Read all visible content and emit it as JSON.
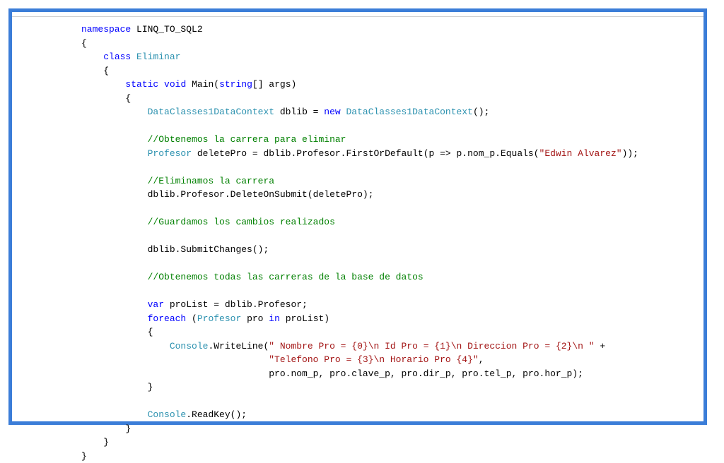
{
  "code": {
    "ns_kw": "namespace",
    "ns_name": " LINQ_TO_SQL2",
    "open1": "{",
    "class_kw": "class",
    "class_name": "Eliminar",
    "open2": "{",
    "static_kw": "static",
    "void_kw": "void",
    "main_name": " Main(",
    "string_kw": "string",
    "main_rest": "[] args)",
    "open3": "{",
    "dc_type1": "DataClasses1DataContext",
    "dc_mid": " dblib = ",
    "new_kw": "new",
    "dc_type2": "DataClasses1DataContext",
    "dc_end": "();",
    "c1": "//Obtenemos la carrera para eliminar",
    "prof_type": "Profesor",
    "del_mid": " deletePro = dblib.Profesor.FirstOrDefault(p => p.nom_p.Equals(",
    "del_str": "\"Edwin Alvarez\"",
    "del_end": "));",
    "c2": "//Eliminamos la carrera",
    "del_stmt": "dblib.Profesor.DeleteOnSubmit(deletePro);",
    "c3": "//Guardamos los cambios realizados",
    "submit": "dblib.SubmitChanges();",
    "c4": "//Obtenemos todas las carreras de la base de datos",
    "var_kw": "var",
    "var_rest": " proList = dblib.Profesor;",
    "foreach_kw": "foreach",
    "fe_p1": " (",
    "fe_type": "Profesor",
    "fe_mid": " pro ",
    "in_kw": "in",
    "fe_rest": " proList)",
    "open4": "{",
    "cons_type": "Console",
    "wl": ".WriteLine(",
    "s1": "\" Nombre Pro = {0}\\n Id Pro = {1}\\n Direccion Pro = {2}\\n \"",
    "plus": " +",
    "s2": "\"Telefono Pro = {3}\\n Horario Pro {4}\"",
    "comma": ",",
    "args_line": "pro.nom_p, pro.clave_p, pro.dir_p, pro.tel_p, pro.hor_p);",
    "close4": "}",
    "cons_type2": "Console",
    "readkey": ".ReadKey();",
    "close3": "}",
    "close2": "}",
    "close1": "}"
  }
}
